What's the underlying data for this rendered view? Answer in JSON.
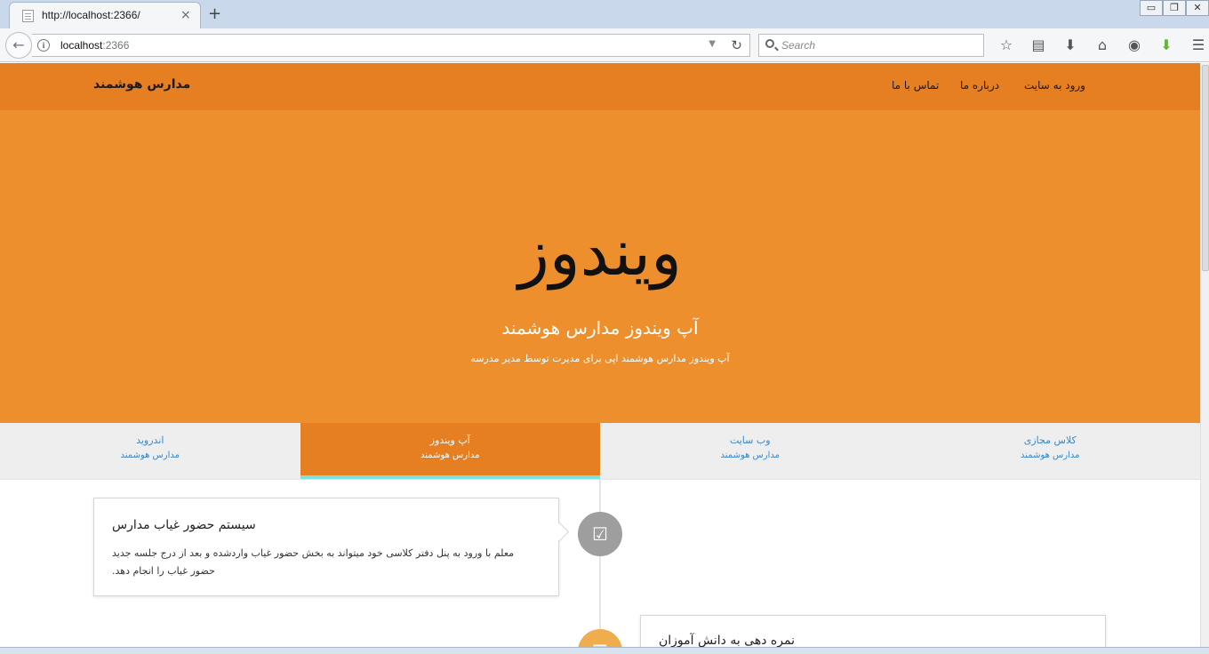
{
  "browser": {
    "tab_title": "http://localhost:2366/",
    "tab_close": "×",
    "new_tab": "+",
    "url_host": "localhost",
    "url_port": ":2366",
    "search_placeholder": "Search",
    "window_buttons": [
      "▭",
      "❐",
      "✕"
    ]
  },
  "site": {
    "brand": "مدارس هوشمند",
    "nav": {
      "login": "ورود به سایت",
      "about": "درباره ما",
      "contact": "تماس با ما"
    },
    "hero": {
      "title": "ویندوز",
      "subtitle": "آپ ویندوز مدارس هوشمند",
      "description": "آپ ویندوز مدارس هوشمند اپی برای مدیرت توسط مدیر مدرسه"
    },
    "tabs": [
      {
        "title": "اندروید",
        "subtitle": "مدارس هوشمند"
      },
      {
        "title": "آپ ویندوز",
        "subtitle": "مدارس هوشمند"
      },
      {
        "title": "وب سایت",
        "subtitle": "مدارس هوشمند"
      },
      {
        "title": "کلاس مجازی",
        "subtitle": "مدارس هوشمند"
      }
    ],
    "active_tab": "آپ ویندوز",
    "timeline": [
      {
        "title": "سیستم حضور غیاب مدارس",
        "body": "معلم با ورود به پنل دفتر کلاسی خود میتواند به بخش حضور غیاب واردشده و بعد از درج جلسه جدید حضور غیاب را انجام دهد.",
        "icon": "check-square-icon"
      },
      {
        "title": "نمره دهی به دانش آموزان",
        "body": "",
        "icon": "list-icon"
      }
    ]
  },
  "colors": {
    "nav_bg": "#e67e22",
    "hero_bg": "#ec8f2c",
    "tab_bar_bg": "#eeeeee",
    "link_blue": "#3a87c7",
    "active_underline": "#7fe0e0"
  }
}
